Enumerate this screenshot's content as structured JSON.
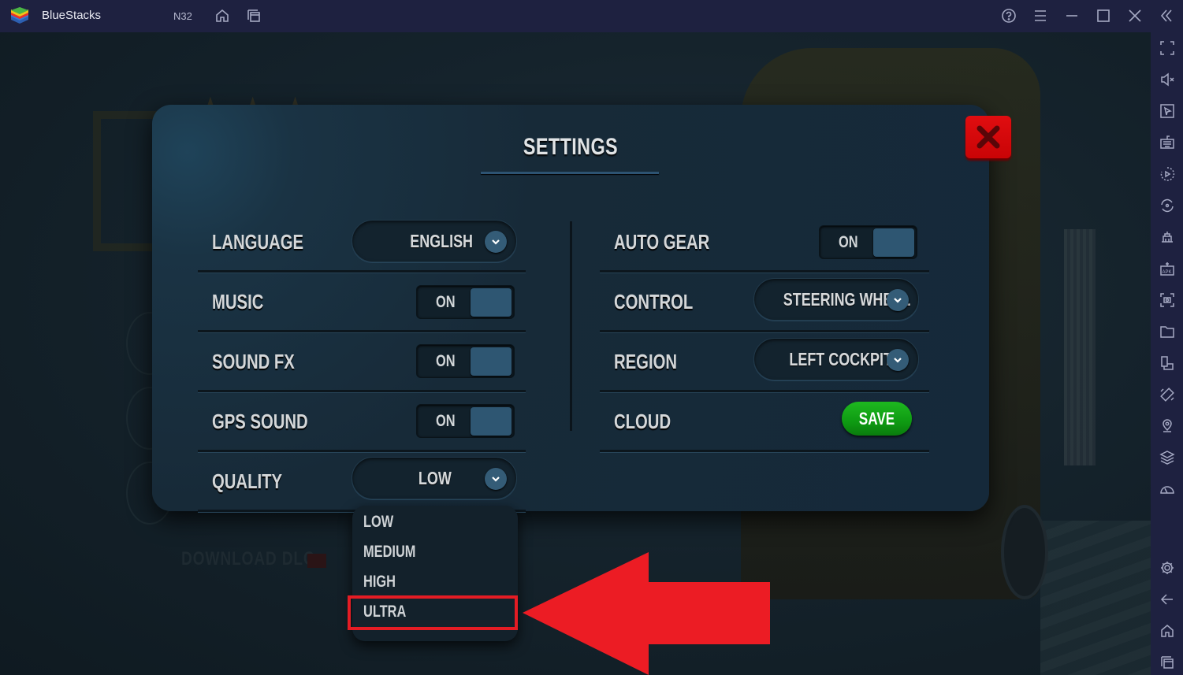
{
  "titlebar": {
    "app_name": "BlueStacks",
    "instance_name": "N32",
    "left_icons": [
      "home-icon",
      "multi-instance-icon"
    ],
    "right_icons": [
      "help-icon",
      "menu-icon",
      "minimize-icon",
      "maximize-icon",
      "close-icon",
      "collapse-sidebar-icon"
    ]
  },
  "sidebar": {
    "top_icons": [
      "fullscreen-icon",
      "mute-volume-icon",
      "cursor-icon",
      "keyboard-controls-icon",
      "macro-recorder-icon",
      "sync-icon",
      "multi-instance-manager-icon",
      "install-apk-icon",
      "screenshot-icon",
      "folder-icon",
      "rotate-screen-icon",
      "shake-icon",
      "location-icon",
      "layers-icon",
      "eco-mode-icon"
    ],
    "bottom_icons": [
      "settings-icon",
      "back-icon",
      "home-icon",
      "recent-apps-icon"
    ]
  },
  "background": {
    "dlc_text": "DOWNLOAD DLC"
  },
  "settings": {
    "title": "SETTINGS",
    "left": [
      {
        "label": "LANGUAGE",
        "type": "dropdown",
        "value": "ENGLISH"
      },
      {
        "label": "MUSIC",
        "type": "toggle",
        "value": "ON"
      },
      {
        "label": "SOUND FX",
        "type": "toggle",
        "value": "ON"
      },
      {
        "label": "GPS SOUND",
        "type": "toggle",
        "value": "ON"
      },
      {
        "label": "QUALITY",
        "type": "dropdown",
        "value": "LOW"
      }
    ],
    "right": [
      {
        "label": "AUTO GEAR",
        "type": "toggle",
        "value": "ON"
      },
      {
        "label": "CONTROL",
        "type": "dropdown",
        "value": "STEERING WHEEL"
      },
      {
        "label": "REGION",
        "type": "dropdown",
        "value": "LEFT COCKPIT"
      },
      {
        "label": "CLOUD",
        "type": "button",
        "value": "SAVE"
      }
    ]
  },
  "quality_dropdown": {
    "options": [
      "LOW",
      "MEDIUM",
      "HIGH",
      "ULTRA"
    ],
    "highlighted": "ULTRA"
  },
  "annotation": {
    "color": "#e41c24"
  }
}
